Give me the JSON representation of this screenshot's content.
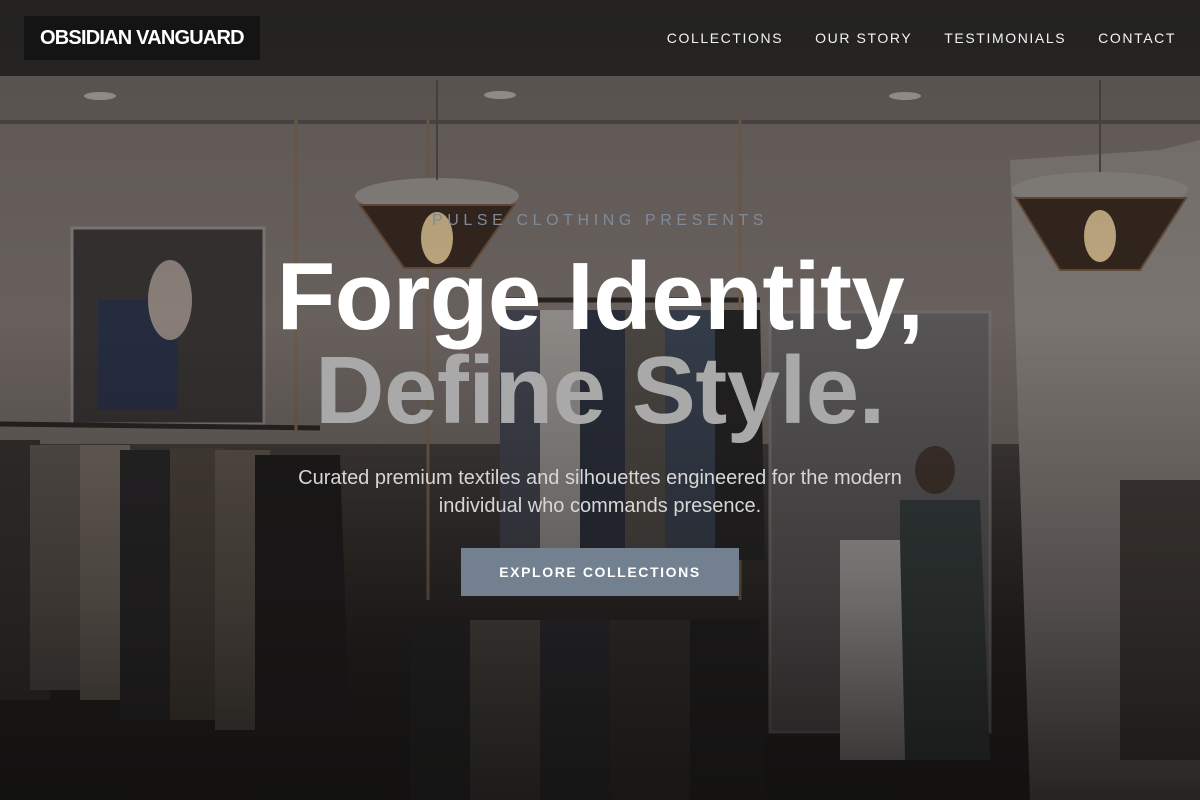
{
  "brand": {
    "name": "OBSIDIAN VANGUARD"
  },
  "nav": {
    "items": [
      {
        "label": "COLLECTIONS"
      },
      {
        "label": "OUR STORY"
      },
      {
        "label": "TESTIMONIALS"
      },
      {
        "label": "CONTACT"
      }
    ]
  },
  "hero": {
    "eyebrow": "PULSE CLOTHING PRESENTS",
    "headline_line1": "Forge Identity,",
    "headline_line2": "Define Style.",
    "subtext": "Curated premium textiles and silhouettes engineered for the modern individual who commands presence.",
    "cta_label": "EXPLORE COLLECTIONS",
    "background": "boutique-interior-photo"
  },
  "colors": {
    "accent": "#72808f",
    "eyebrow": "#7f8a99",
    "nav_background": "#1e1d1c",
    "headline_secondary": "#a9a9a9"
  }
}
